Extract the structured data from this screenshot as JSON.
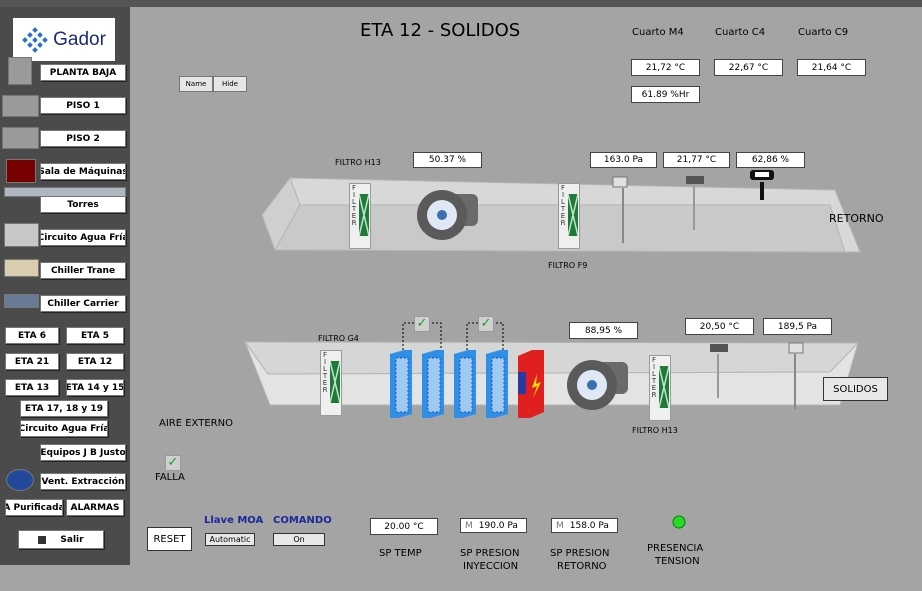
{
  "title": "ETA 12 - SOLIDOS",
  "logo": {
    "text": "Gador"
  },
  "sidebar": {
    "planta_baja": "PLANTA BAJA",
    "piso1": "PISO 1",
    "piso2": "PISO 2",
    "sala_maquinas": "Sala de Máquinas",
    "torres": "Torres",
    "circuito_agua_fria": "Circuito Agua Fría",
    "chiller_trane": "Chiller Trane",
    "chiller_carrier": "Chiller Carrier",
    "eta6": "ETA 6",
    "eta5": "ETA 5",
    "eta21": "ETA 21",
    "eta12": "ETA 12",
    "eta13": "ETA 13",
    "eta14_15": "ETA 14 y 15",
    "eta17_18_19": "ETA 17, 18 y 19",
    "circuito_agua_fria2": "Circuito Agua Fría",
    "equipos_jb": "Equipos J B Justo",
    "vent_extraccion": "Vent. Extracción",
    "a_purificada": "A Purificada",
    "alarmas": "ALARMAS",
    "salir": "Salir"
  },
  "toolbar": {
    "name": "Name",
    "hide": "Hide"
  },
  "rooms": {
    "m4_label": "Cuarto M4",
    "c4_label": "Cuarto C4",
    "c9_label": "Cuarto C9",
    "m4_temp": "21,72 °C",
    "c4_temp": "22,67 °C",
    "c9_temp": "21,64 °C",
    "m4_hum": "61.89 %Hr"
  },
  "return_duct": {
    "filtro_h13_label": "FILTRO H13",
    "filtro_h13_value": "50.37 %",
    "pressure": "163.0 Pa",
    "temp": "21,77 °C",
    "humidity": "62,86 %",
    "filtro_f9_label": "FILTRO F9",
    "retorno_label": "RETORNO"
  },
  "supply_duct": {
    "filtro_g4_label": "FILTRO G4",
    "fan_value": "88,95 %",
    "temp": "20,50 °C",
    "pressure": "189,5 Pa",
    "filtro_h13_label": "FILTRO H13",
    "solidos_button": "SOLIDOS",
    "aire_externo": "AIRE EXTERNO",
    "filter_text": "FILTER"
  },
  "falla_label": "FALLA",
  "bottom": {
    "reset": "RESET",
    "llave_moa_label": "Llave MOA",
    "llave_moa_value": "Automatic",
    "comando_label": "COMANDO",
    "comando_value": "On",
    "sp_temp_value": "20.00 °C",
    "sp_temp_label": "SP TEMP",
    "sp_pres_iny_prefix": "M",
    "sp_pres_iny_value": "190.0 Pa",
    "sp_pres_iny_label1": "SP PRESION",
    "sp_pres_iny_label2": "INYECCION",
    "sp_pres_ret_prefix": "M",
    "sp_pres_ret_value": "158.0 Pa",
    "sp_pres_ret_label1": "SP PRESION",
    "sp_pres_ret_label2": "RETORNO",
    "presencia_label1": "PRESENCIA",
    "presencia_label2": "TENSION"
  },
  "colors": {
    "background": "#a4a4a4",
    "sidebar": "#4b4b4b",
    "coil_blue": "#2f8ee8",
    "heater_red": "#e02020",
    "status_green": "#22dd22",
    "moa_blue": "#1a2a9a"
  },
  "checkmark_glyph": "✓"
}
